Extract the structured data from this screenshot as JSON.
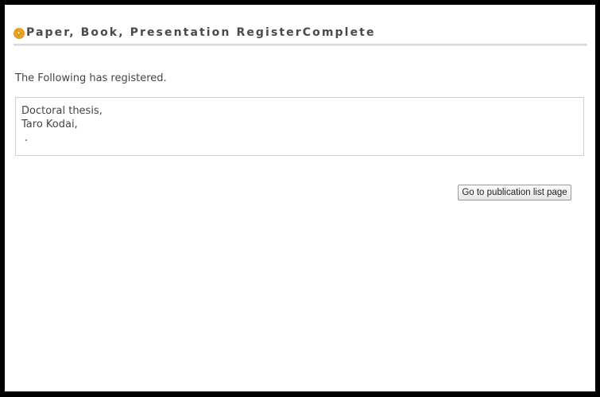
{
  "page": {
    "title": "Paper, Book, Presentation RegisterComplete",
    "title_icon": "pen-bullet-icon",
    "message": "The Following has registered."
  },
  "detail": {
    "lines": [
      "Doctoral thesis,",
      "Taro Kodai,",
      "."
    ]
  },
  "actions": {
    "publication_list_label": "Go to publication list page"
  },
  "colors": {
    "frame": "#000000",
    "background": "#ffffff",
    "title_text": "#4a4a4a",
    "body_text": "#444444",
    "icon_orange": "#f0a418",
    "box_border": "#cfcfcf"
  }
}
